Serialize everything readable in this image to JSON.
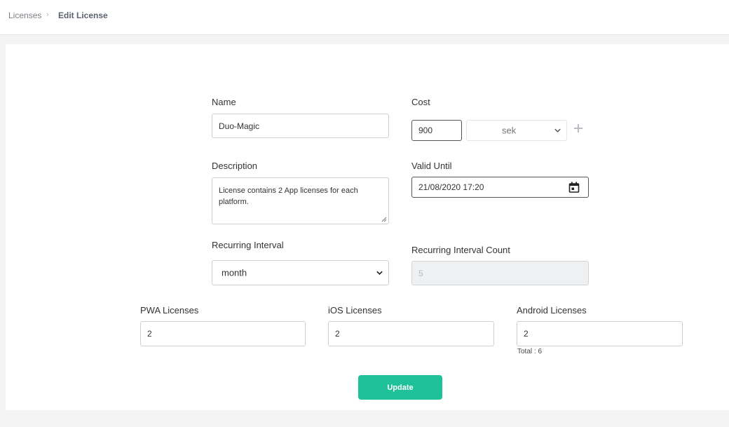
{
  "breadcrumb": {
    "items": [
      "Licenses",
      "Edit License"
    ],
    "separator": "›"
  },
  "form": {
    "name": {
      "label": "Name",
      "value": "Duo-Magic"
    },
    "cost": {
      "label": "Cost",
      "value": "900",
      "currency": "sek",
      "add_icon": "plus-icon"
    },
    "description": {
      "label": "Description",
      "value": "License contains 2 App licenses for each platform."
    },
    "valid_until": {
      "label": "Valid Until",
      "value": "21/08/2020 17:20",
      "icon": "calendar-icon"
    },
    "recurring_interval": {
      "label": "Recurring Interval",
      "value": "month"
    },
    "recurring_interval_count": {
      "label": "Recurring Interval Count",
      "value": "5"
    },
    "pwa": {
      "label": "PWA Licenses",
      "value": "2"
    },
    "ios": {
      "label": "iOS Licenses",
      "value": "2"
    },
    "android": {
      "label": "Android Licenses",
      "value": "2"
    },
    "total": "Total : 6",
    "submit_label": "Update"
  },
  "colors": {
    "accent": "#1fc19a",
    "background": "#f4f4f4"
  }
}
